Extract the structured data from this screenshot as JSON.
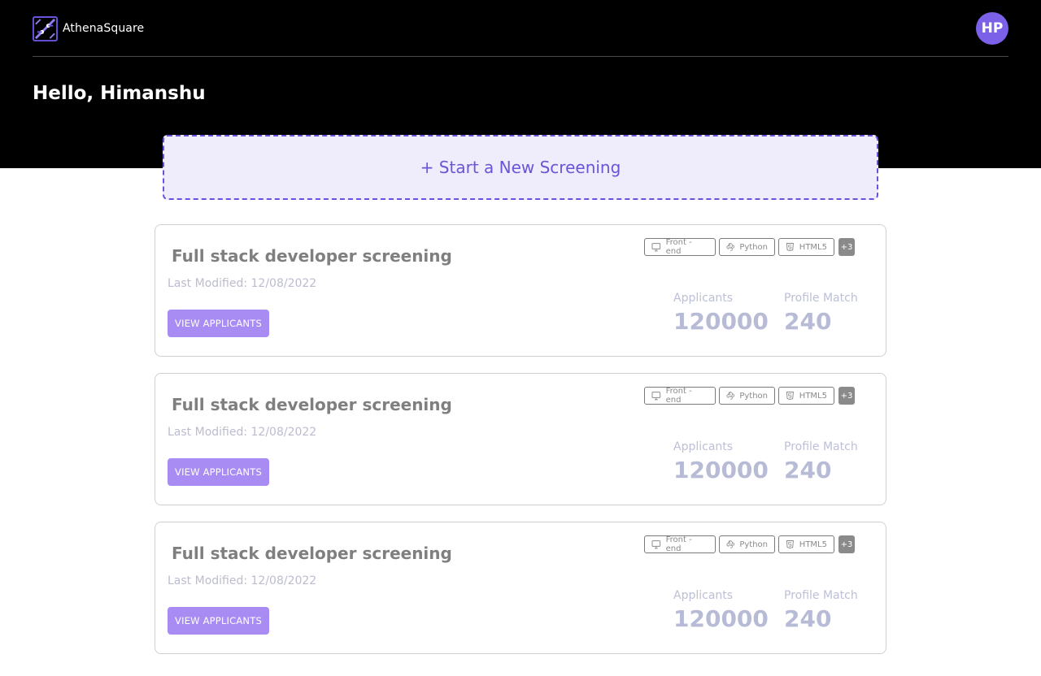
{
  "app": {
    "brand": "AthenaSquare",
    "user_initials": "HP"
  },
  "greeting": "Hello, Himanshu",
  "new_screening_label": "+ Start a New Screening",
  "colors": {
    "accent": "#6b52dd",
    "button": "#a88cf3",
    "header_bg": "#000000",
    "avatar": "#7b61e8"
  },
  "screenings": [
    {
      "title": "Full stack developer screening",
      "last_modified": "Last Modified: 12/08/2022",
      "button_label": "VIEW APPLICANTS",
      "tags": [
        {
          "label": "Front - end",
          "icon": "monitor-icon"
        },
        {
          "label": "Python",
          "icon": "python-icon"
        },
        {
          "label": "HTML5",
          "icon": "html5-icon"
        }
      ],
      "more_tags": "+3",
      "applicants_label": "Applicants",
      "applicants_value": "120000",
      "match_label": "Profile Match",
      "match_value": "240"
    },
    {
      "title": "Full stack developer screening",
      "last_modified": "Last Modified: 12/08/2022",
      "button_label": "VIEW APPLICANTS",
      "tags": [
        {
          "label": "Front - end",
          "icon": "monitor-icon"
        },
        {
          "label": "Python",
          "icon": "python-icon"
        },
        {
          "label": "HTML5",
          "icon": "html5-icon"
        }
      ],
      "more_tags": "+3",
      "applicants_label": "Applicants",
      "applicants_value": "120000",
      "match_label": "Profile Match",
      "match_value": "240"
    },
    {
      "title": "Full stack developer screening",
      "last_modified": "Last Modified: 12/08/2022",
      "button_label": "VIEW APPLICANTS",
      "tags": [
        {
          "label": "Front - end",
          "icon": "monitor-icon"
        },
        {
          "label": "Python",
          "icon": "python-icon"
        },
        {
          "label": "HTML5",
          "icon": "html5-icon"
        }
      ],
      "more_tags": "+3",
      "applicants_label": "Applicants",
      "applicants_value": "120000",
      "match_label": "Profile Match",
      "match_value": "240"
    }
  ]
}
